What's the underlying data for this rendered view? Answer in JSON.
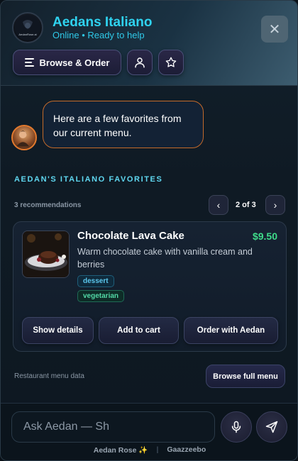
{
  "header": {
    "logo_text": "AedanRose.ai",
    "title": "Aedans Italiano",
    "status": "Online • Ready to help",
    "close_label": "✕",
    "browse_label": "Browse & Order"
  },
  "chat": {
    "bot_message": "Here are a few favorites from our current menu."
  },
  "recommendations": {
    "section_title": "AEDAN'S ITALIANO FAVORITES",
    "count_label": "3 recommendations",
    "pager": "2 of 3",
    "prev_label": "‹",
    "next_label": "›"
  },
  "card": {
    "name": "Chocolate Lava Cake",
    "price": "$9.50",
    "description": "Warm chocolate cake with vanilla cream and berries",
    "tags": [
      "dessert",
      "vegetarian"
    ],
    "buttons": {
      "details": "Show details",
      "cart": "Add to cart",
      "order": "Order with Aedan"
    }
  },
  "source": {
    "label": "Restaurant menu data",
    "browse_full": "Browse full menu"
  },
  "input": {
    "value": "",
    "placeholder": "Ask Aedan — Sh"
  },
  "footer": {
    "left": "Aedan Rose ✨",
    "separator": "|",
    "right": "Gaazzeebo"
  },
  "colors": {
    "accent_cyan": "#2fd3f0",
    "price_green": "#3fdc8a",
    "avatar_ring": "#e37a2e"
  }
}
